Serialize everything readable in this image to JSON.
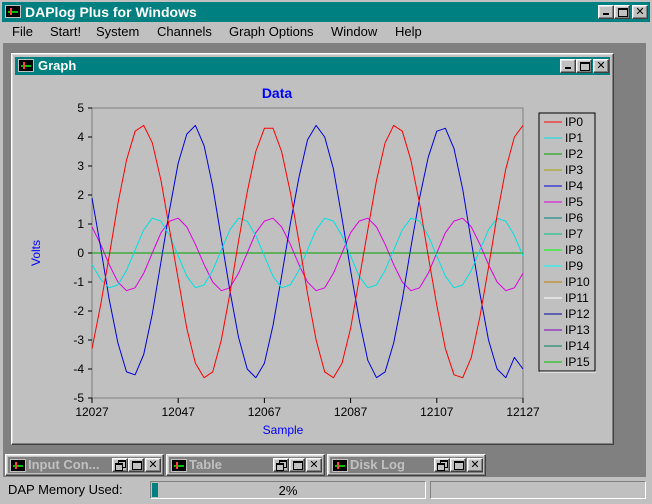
{
  "app": {
    "title": "DAPlog Plus for Windows"
  },
  "menu": {
    "items": [
      "File",
      "Start!",
      "System",
      "Channels",
      "Graph Options",
      "Window",
      "Help"
    ]
  },
  "graph_window": {
    "title": "Graph"
  },
  "minimized_windows": [
    {
      "title": "Input Con..."
    },
    {
      "title": "Table"
    },
    {
      "title": "Disk Log"
    }
  ],
  "status": {
    "memory_label": "DAP Memory Used:",
    "memory_percent_text": "2%",
    "memory_fraction": 0.02
  },
  "colors": {
    "title_active": "#008080",
    "title_inactive": "#808080",
    "plot_title": "#0000ff",
    "axis_label": "#0000ff"
  },
  "chart_data": {
    "type": "line",
    "title": "Data",
    "xlabel": "Sample",
    "ylabel": "Volts",
    "xlim": [
      12027,
      12127
    ],
    "ylim": [
      -5,
      5
    ],
    "x_ticks": [
      12027,
      12047,
      12067,
      12087,
      12107,
      12127
    ],
    "y_ticks": [
      5,
      4,
      3,
      2,
      1,
      0,
      -1,
      -2,
      -3,
      -4,
      -5
    ],
    "grid": false,
    "legend_position": "right",
    "x": [
      12027,
      12029,
      12031,
      12033,
      12035,
      12037,
      12039,
      12041,
      12043,
      12045,
      12047,
      12049,
      12051,
      12053,
      12055,
      12057,
      12059,
      12061,
      12063,
      12065,
      12067,
      12069,
      12071,
      12073,
      12075,
      12077,
      12079,
      12081,
      12083,
      12085,
      12087,
      12089,
      12091,
      12093,
      12095,
      12097,
      12099,
      12101,
      12103,
      12105,
      12107,
      12109,
      12111,
      12113,
      12115,
      12117,
      12119,
      12121,
      12123,
      12125,
      12127
    ],
    "series": [
      {
        "name": "IP0",
        "color": "#ff0000",
        "values": [
          -3.3,
          -1.8,
          -0.1,
          1.7,
          3.2,
          4.2,
          4.4,
          3.8,
          2.5,
          0.8,
          -0.9,
          -2.6,
          -3.8,
          -4.3,
          -4.1,
          -3.0,
          -1.4,
          0.4,
          2.1,
          3.5,
          4.3,
          4.3,
          3.5,
          2.1,
          0.4,
          -1.4,
          -3.0,
          -4.1,
          -4.3,
          -3.8,
          -2.6,
          -0.9,
          0.8,
          2.5,
          3.8,
          4.4,
          4.2,
          3.2,
          1.7,
          -0.1,
          -1.8,
          -3.3,
          -4.2,
          -4.3,
          -3.6,
          -2.2,
          -0.5,
          1.3,
          2.9,
          4.0,
          4.4
        ]
      },
      {
        "name": "IP1",
        "color": "#00e0e0",
        "values": [
          -0.4,
          -0.9,
          -1.2,
          -1.1,
          -0.6,
          0.1,
          0.8,
          1.2,
          1.1,
          0.6,
          -0.1,
          -0.8,
          -1.2,
          -1.1,
          -0.6,
          0.1,
          0.8,
          1.2,
          1.1,
          0.6,
          -0.1,
          -0.8,
          -1.2,
          -1.1,
          -0.6,
          0.1,
          0.8,
          1.2,
          1.1,
          0.6,
          -0.1,
          -0.8,
          -1.2,
          -1.1,
          -0.6,
          0.1,
          0.8,
          1.2,
          1.1,
          0.6,
          -0.1,
          -0.8,
          -1.2,
          -1.1,
          -0.6,
          0.1,
          0.8,
          1.2,
          1.1,
          0.6,
          -0.1
        ]
      },
      {
        "name": "IP2",
        "color": "#00a000",
        "values": [
          0,
          0,
          0,
          0,
          0,
          0,
          0,
          0,
          0,
          0,
          0,
          0,
          0,
          0,
          0,
          0,
          0,
          0,
          0,
          0,
          0,
          0,
          0,
          0,
          0,
          0,
          0,
          0,
          0,
          0,
          0,
          0,
          0,
          0,
          0,
          0,
          0,
          0,
          0,
          0,
          0,
          0,
          0,
          0,
          0,
          0,
          0,
          0,
          0,
          0,
          0
        ]
      },
      {
        "name": "IP3",
        "color": "#a0a000",
        "values": [
          0,
          0,
          0,
          0,
          0,
          0,
          0,
          0,
          0,
          0,
          0,
          0,
          0,
          0,
          0,
          0,
          0,
          0,
          0,
          0,
          0,
          0,
          0,
          0,
          0,
          0,
          0,
          0,
          0,
          0,
          0,
          0,
          0,
          0,
          0,
          0,
          0,
          0,
          0,
          0,
          0,
          0,
          0,
          0,
          0,
          0,
          0,
          0,
          0,
          0,
          0
        ]
      },
      {
        "name": "IP4",
        "color": "#0000e0",
        "values": [
          1.9,
          0.2,
          -1.6,
          -3.1,
          -4.1,
          -4.2,
          -3.5,
          -2.1,
          -0.3,
          1.5,
          3.1,
          4.1,
          4.4,
          3.7,
          2.3,
          0.5,
          -1.3,
          -2.9,
          -4.0,
          -4.3,
          -3.8,
          -2.5,
          -0.8,
          1.0,
          2.6,
          3.9,
          4.4,
          4.0,
          2.9,
          1.2,
          -0.6,
          -2.3,
          -3.7,
          -4.3,
          -4.1,
          -3.1,
          -1.6,
          0.2,
          1.9,
          3.3,
          4.2,
          4.3,
          3.6,
          2.2,
          0.4,
          -1.4,
          -3.0,
          -4.0,
          -4.3,
          -3.6,
          -4.0
        ]
      },
      {
        "name": "IP5",
        "color": "#e000e0",
        "values": [
          0.9,
          0.3,
          -0.4,
          -1.0,
          -1.3,
          -1.2,
          -0.7,
          0.0,
          0.7,
          1.1,
          1.2,
          0.9,
          0.3,
          -0.4,
          -1.0,
          -1.3,
          -1.2,
          -0.7,
          0.0,
          0.7,
          1.1,
          1.2,
          0.9,
          0.3,
          -0.4,
          -1.0,
          -1.3,
          -1.2,
          -0.7,
          0.0,
          0.7,
          1.1,
          1.2,
          0.9,
          0.3,
          -0.4,
          -1.0,
          -1.3,
          -1.2,
          -0.7,
          0.0,
          0.7,
          1.1,
          1.2,
          0.9,
          0.3,
          -0.4,
          -1.0,
          -1.3,
          -1.2,
          -0.7
        ]
      },
      {
        "name": "IP6",
        "color": "#008080",
        "values": [
          0,
          0,
          0,
          0,
          0,
          0,
          0,
          0,
          0,
          0,
          0,
          0,
          0,
          0,
          0,
          0,
          0,
          0,
          0,
          0,
          0,
          0,
          0,
          0,
          0,
          0,
          0,
          0,
          0,
          0,
          0,
          0,
          0,
          0,
          0,
          0,
          0,
          0,
          0,
          0,
          0,
          0,
          0,
          0,
          0,
          0,
          0,
          0,
          0,
          0,
          0
        ]
      },
      {
        "name": "IP7",
        "color": "#00c080",
        "values": [
          0,
          0,
          0,
          0,
          0,
          0,
          0,
          0,
          0,
          0,
          0,
          0,
          0,
          0,
          0,
          0,
          0,
          0,
          0,
          0,
          0,
          0,
          0,
          0,
          0,
          0,
          0,
          0,
          0,
          0,
          0,
          0,
          0,
          0,
          0,
          0,
          0,
          0,
          0,
          0,
          0,
          0,
          0,
          0,
          0,
          0,
          0,
          0,
          0,
          0,
          0
        ]
      },
      {
        "name": "IP8",
        "color": "#00ff00",
        "values": [
          0,
          0,
          0,
          0,
          0,
          0,
          0,
          0,
          0,
          0,
          0,
          0,
          0,
          0,
          0,
          0,
          0,
          0,
          0,
          0,
          0,
          0,
          0,
          0,
          0,
          0,
          0,
          0,
          0,
          0,
          0,
          0,
          0,
          0,
          0,
          0,
          0,
          0,
          0,
          0,
          0,
          0,
          0,
          0,
          0,
          0,
          0,
          0,
          0,
          0,
          0
        ]
      }
    ],
    "legend_entries": [
      {
        "name": "IP0",
        "color": "#ff0000"
      },
      {
        "name": "IP1",
        "color": "#00e0e0"
      },
      {
        "name": "IP2",
        "color": "#00a000"
      },
      {
        "name": "IP3",
        "color": "#a0a000"
      },
      {
        "name": "IP4",
        "color": "#0000e0"
      },
      {
        "name": "IP5",
        "color": "#e000e0"
      },
      {
        "name": "IP6",
        "color": "#008080"
      },
      {
        "name": "IP7",
        "color": "#00c080"
      },
      {
        "name": "IP8",
        "color": "#00ff00"
      },
      {
        "name": "IP9",
        "color": "#00ffff"
      },
      {
        "name": "IP10",
        "color": "#c08000"
      },
      {
        "name": "IP11",
        "color": "#ffffff"
      },
      {
        "name": "IP12",
        "color": "#0000a0"
      },
      {
        "name": "IP13",
        "color": "#8000c0"
      },
      {
        "name": "IP14",
        "color": "#008060"
      },
      {
        "name": "IP15",
        "color": "#00c000"
      }
    ]
  }
}
